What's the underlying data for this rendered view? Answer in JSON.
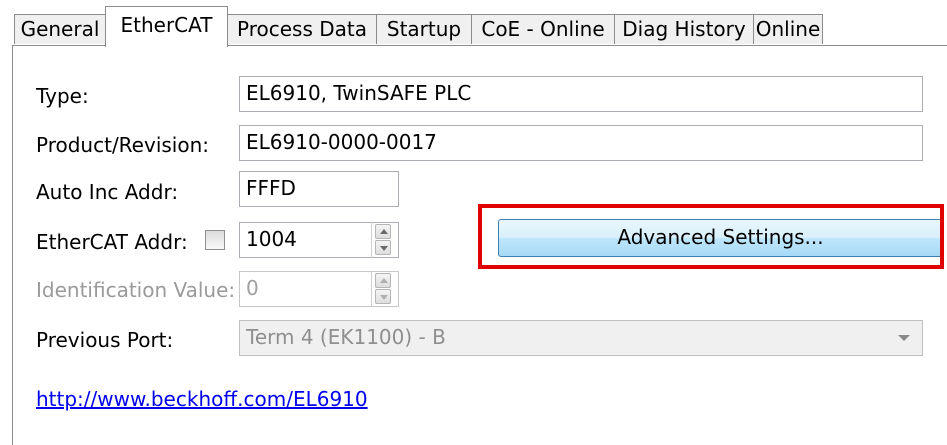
{
  "tabs": [
    {
      "label": "General"
    },
    {
      "label": "EtherCAT"
    },
    {
      "label": "Process Data"
    },
    {
      "label": "Startup"
    },
    {
      "label": "CoE - Online"
    },
    {
      "label": "Diag History"
    },
    {
      "label": "Online"
    }
  ],
  "active_tab": "EtherCAT",
  "form": {
    "type": {
      "label": "Type:",
      "value": "EL6910, TwinSAFE PLC"
    },
    "product_revision": {
      "label": "Product/Revision:",
      "value": "EL6910-0000-0017"
    },
    "auto_inc_addr": {
      "label": "Auto Inc Addr:",
      "value": "FFFD"
    },
    "ethercat_addr": {
      "label": "EtherCAT Addr:",
      "value": "1004",
      "checked": false
    },
    "identification_value": {
      "label": "Identification Value:",
      "value": "0",
      "enabled": false
    },
    "previous_port": {
      "label": "Previous Port:",
      "value": "Term 4 (EK1100) - B",
      "enabled": false
    }
  },
  "advanced_button": {
    "label": "Advanced Settings..."
  },
  "link": {
    "text": "http://www.beckhoff.com/EL6910"
  },
  "colors": {
    "highlight": "#e00000",
    "link": "#0000ee"
  }
}
